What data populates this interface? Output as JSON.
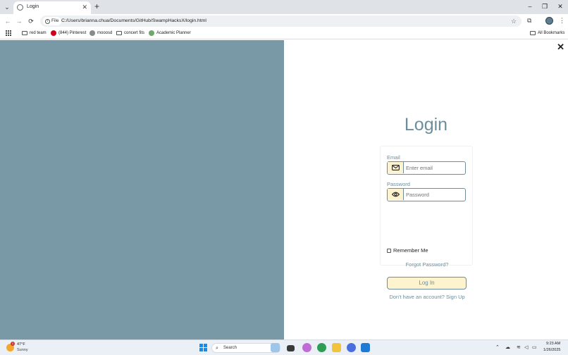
{
  "browser": {
    "tab": {
      "title": "Login"
    },
    "address": {
      "scheme_chip": "File",
      "url": "C:/Users/brianna.chua/Documents/GitHub/SwampHacksX/login.html"
    },
    "bookmarks": [
      {
        "label": "red team"
      },
      {
        "label": "(844) Pinterest"
      },
      {
        "label": "mooosd"
      },
      {
        "label": "concert fits"
      },
      {
        "label": "Academic Planner"
      }
    ],
    "all_bookmarks_label": "All Bookmarks"
  },
  "login": {
    "title": "Login",
    "email_label": "Email",
    "email_placeholder": "Enter email",
    "email_value": "",
    "password_label": "Password",
    "password_placeholder": "Password",
    "password_value": "",
    "remember_label": "Remember Me",
    "remember_checked": false,
    "forgot_label": "Forgot Password?",
    "login_button": "Log In",
    "signup_text": "Don't have an account? Sign Up"
  },
  "taskbar": {
    "weather_temp": "47°F",
    "weather_desc": "Sunny",
    "weather_badge": "1",
    "search_label": "Search",
    "time": "9:23 AM",
    "date": "1/26/2025"
  },
  "colors": {
    "accent": "#6c8e9c",
    "left_panel": "#7a99a6",
    "button_fill": "#fdf3cf"
  },
  "icons": {
    "email_field": "mail-icon",
    "password_field": "eye-icon"
  }
}
